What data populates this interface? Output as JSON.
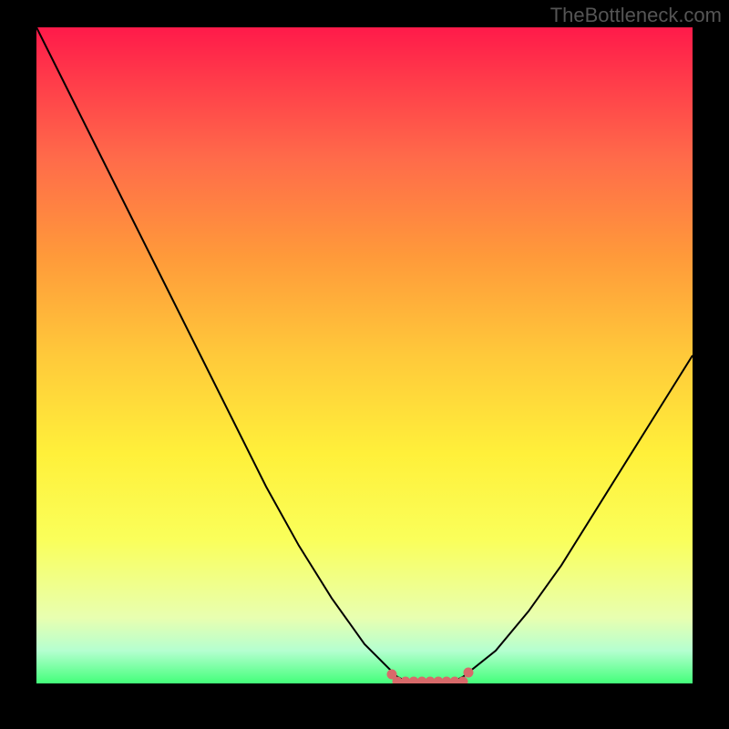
{
  "watermark": "TheBottleneck.com",
  "chart_data": {
    "type": "line",
    "title": "",
    "xlabel": "",
    "ylabel": "",
    "xlim": [
      0,
      100
    ],
    "ylim": [
      0,
      100
    ],
    "series": [
      {
        "name": "curve",
        "x": [
          0,
          5,
          10,
          15,
          20,
          25,
          30,
          35,
          40,
          45,
          50,
          55,
          57,
          60,
          63,
          65,
          70,
          75,
          80,
          85,
          90,
          95,
          100
        ],
        "y": [
          100,
          90,
          80,
          70,
          60,
          50,
          40,
          30,
          21,
          13,
          6,
          1,
          0,
          0,
          0,
          1,
          5,
          11,
          18,
          26,
          34,
          42,
          50
        ]
      }
    ],
    "annotations": [
      {
        "type": "dots",
        "x_range": [
          55,
          65
        ],
        "y": 0,
        "color": "#d86a6a"
      }
    ],
    "background_gradient": {
      "top": "#ff1a4a",
      "bottom": "#43ff7a"
    }
  }
}
